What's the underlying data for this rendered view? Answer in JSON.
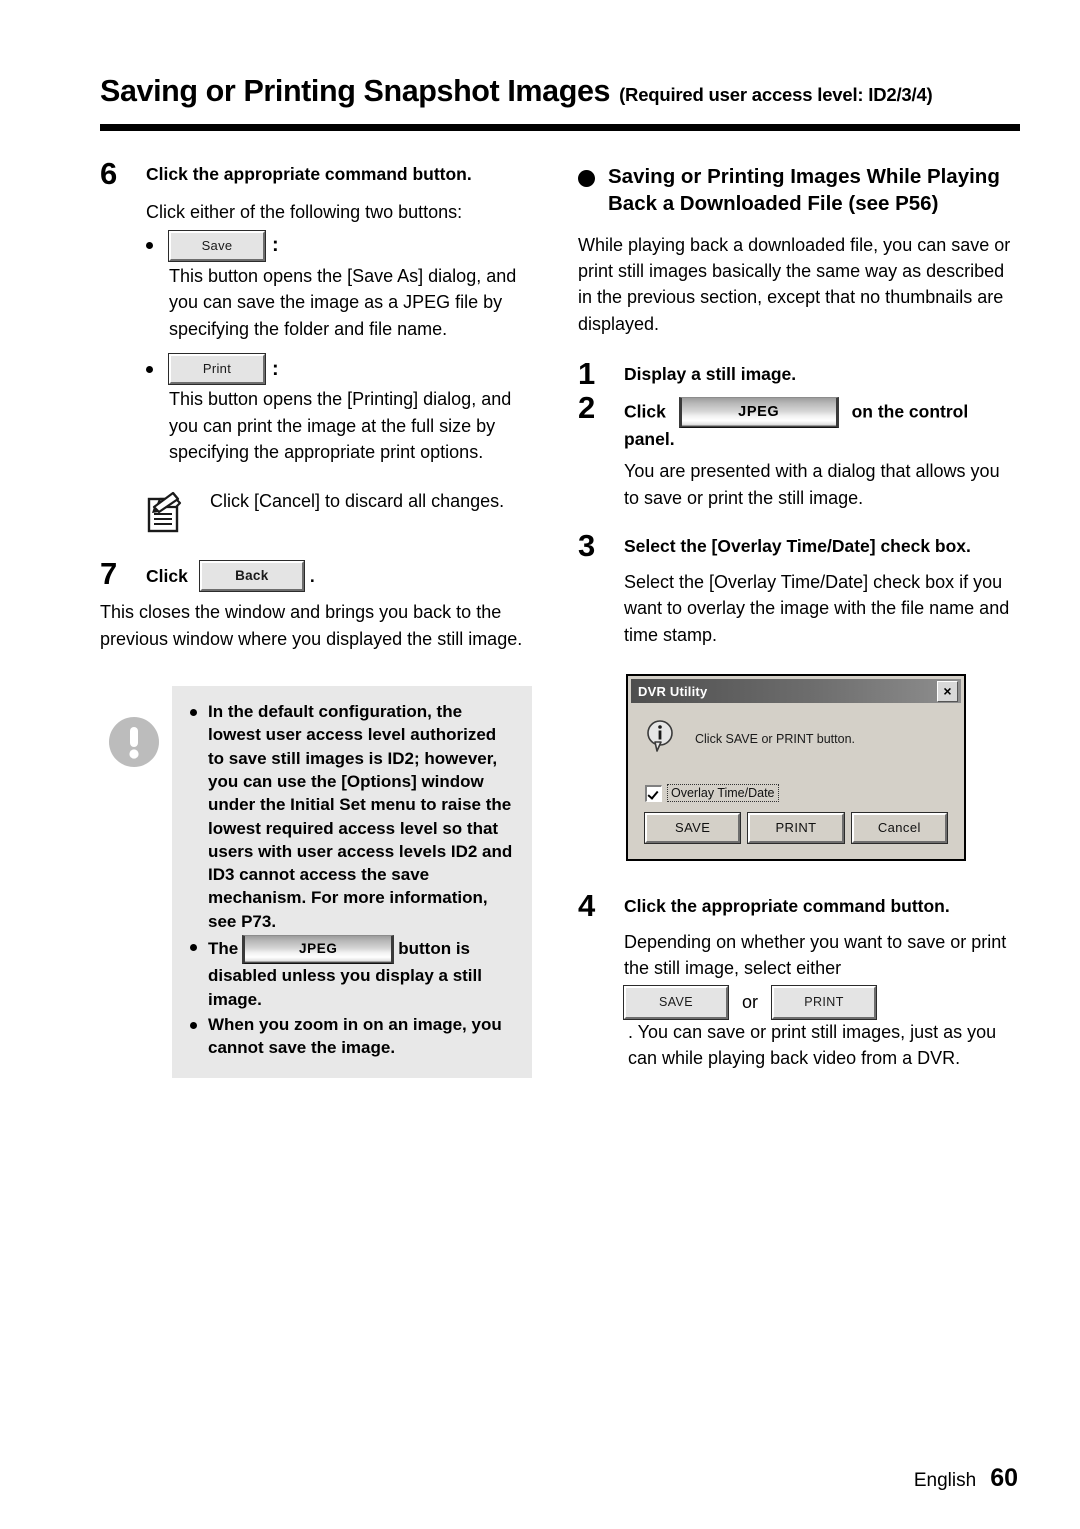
{
  "header": {
    "title": "Saving or Printing Snapshot Images",
    "subtitle": "(Required user access level: ID2/3/4)"
  },
  "left_column": {
    "step6": {
      "number": "6",
      "title": "Click the appropriate command button.",
      "intro": "Click either of the following two buttons:",
      "bullets": [
        {
          "button_label": "Save",
          "separator": ":",
          "description": "This button opens the [Save As] dialog, and you can save the image as a JPEG file by specifying the folder and file name."
        },
        {
          "button_label": "Print",
          "separator": ":",
          "description": "This button opens the [Printing] dialog, and you can print the image at the full size by specifying the appropriate print options."
        }
      ],
      "note": "Click [Cancel] to discard all changes."
    },
    "step7": {
      "number": "7",
      "click_label": "Click",
      "button_label": "Back",
      "period": ".",
      "body": "This closes the window and brings you back to the previous window where you displayed the still image."
    },
    "caution": {
      "items": [
        {
          "text": "In the default configuration, the lowest user access level authorized to save still images is ID2; however, you can use the [Options] window under the Initial Set menu to raise the lowest required access level so that users with user access levels ID2 and ID3 cannot access the save mechanism. For more information, see P73."
        },
        {
          "text_before": "The",
          "button_label": "JPEG",
          "text_after": "button is disabled unless you display a still image."
        },
        {
          "text": "When you zoom in on an image, you cannot save the image."
        }
      ]
    }
  },
  "right_column": {
    "section": {
      "title": "Saving or Printing Images While Playing Back a Downloaded File (see P56)",
      "intro": "While playing back a downloaded file, you can save or print still images basically the same way as described in the previous section, except that no thumbnails are displayed."
    },
    "step1": {
      "number": "1",
      "title": "Display a still image."
    },
    "step2": {
      "number": "2",
      "title_before": "Click",
      "button_label": "JPEG",
      "title_after": "on the control panel.",
      "body": "You are presented with a dialog that allows you to save or print the still image."
    },
    "step3": {
      "number": "3",
      "title": "Select the [Overlay Time/Date] check box.",
      "body": "Select the [Overlay Time/Date] check box if you want to overlay the image with the file name and time stamp."
    },
    "dialog": {
      "title": "DVR Utility",
      "close_label": "×",
      "message": "Click SAVE or PRINT button.",
      "checkbox_label": "Overlay Time/Date",
      "checkbox_checked": true,
      "buttons": [
        "SAVE",
        "PRINT",
        "Cancel"
      ]
    },
    "step4": {
      "number": "4",
      "title": "Click the appropriate command button.",
      "body_line1": "Depending on whether you want to save or print the still image, select either",
      "button_save": "SAVE",
      "or_text": "or",
      "button_print": "PRINT",
      "body_line2": ". You can save or print still images, just as you can while playing back video from a DVR."
    }
  },
  "footer": {
    "language": "English",
    "page": "60"
  }
}
